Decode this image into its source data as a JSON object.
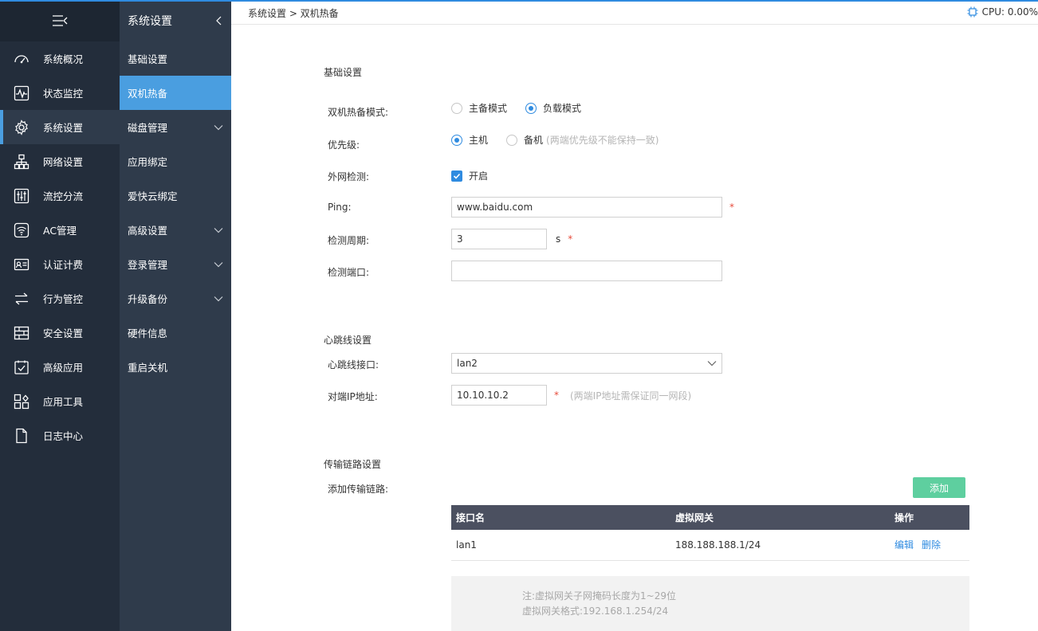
{
  "header": {
    "breadcrumb": "系统设置 > 双机热备",
    "cpu": "CPU: 0.00%"
  },
  "sidebar": {
    "items": [
      {
        "label": "系统概况",
        "icon": "dashboard-icon"
      },
      {
        "label": "状态监控",
        "icon": "monitor-icon"
      },
      {
        "label": "系统设置",
        "icon": "gear-icon"
      },
      {
        "label": "网络设置",
        "icon": "network-icon"
      },
      {
        "label": "流控分流",
        "icon": "sliders-icon"
      },
      {
        "label": "AC管理",
        "icon": "wifi-icon"
      },
      {
        "label": "认证计费",
        "icon": "id-card-icon"
      },
      {
        "label": "行为管控",
        "icon": "arrows-icon"
      },
      {
        "label": "安全设置",
        "icon": "firewall-icon"
      },
      {
        "label": "高级应用",
        "icon": "checklist-icon"
      },
      {
        "label": "应用工具",
        "icon": "grid-tools-icon"
      },
      {
        "label": "日志中心",
        "icon": "document-icon"
      }
    ]
  },
  "subnav": {
    "title": "系统设置",
    "items": [
      {
        "label": "基础设置"
      },
      {
        "label": "双机热备"
      },
      {
        "label": "磁盘管理"
      },
      {
        "label": "应用绑定"
      },
      {
        "label": "爱快云绑定"
      },
      {
        "label": "高级设置"
      },
      {
        "label": "登录管理"
      },
      {
        "label": "升级备份"
      },
      {
        "label": "硬件信息"
      },
      {
        "label": "重启关机"
      }
    ]
  },
  "basic": {
    "section_title": "基础设置",
    "mode_label": "双机热备模式:",
    "mode_options": [
      "主备模式",
      "负载模式"
    ],
    "priority_label": "优先级:",
    "priority_options": [
      "主机",
      "备机"
    ],
    "priority_hint": "(两端优先级不能保持一致)",
    "wan_check_label": "外网检测:",
    "wan_check_option": "开启",
    "ping_label": "Ping:",
    "ping_value": "www.baidu.com",
    "period_label": "检测周期:",
    "period_value": "3",
    "period_unit": "s",
    "port_label": "检测端口:",
    "port_value": "",
    "required_mark": "*"
  },
  "heartbeat": {
    "section_title": "心跳线设置",
    "interface_label": "心跳线接口:",
    "interface_value": "lan2",
    "peer_ip_label": "对端IP地址:",
    "peer_ip_value": "10.10.10.2",
    "peer_ip_hint": "(两端IP地址需保证同一网段)"
  },
  "transport": {
    "section_title": "传输链路设置",
    "add_label": "添加传输链路:",
    "add_button": "添加",
    "columns": [
      "接口名",
      "虚拟网关",
      "操作"
    ],
    "rows": [
      {
        "interface": "lan1",
        "gateway": "188.188.188.1/24",
        "edit": "编辑",
        "delete": "删除"
      }
    ],
    "note_line1": "注:虚拟网关子网掩码长度为1~29位",
    "note_line2": "虚拟网关格式:192.168.1.254/24"
  },
  "colors": {
    "accent": "#4a9ee0",
    "sidebar_bg": "#232d3b",
    "subnav_bg": "#2f3b4b",
    "add_button": "#5ecf9f",
    "table_header": "#4b5060"
  }
}
